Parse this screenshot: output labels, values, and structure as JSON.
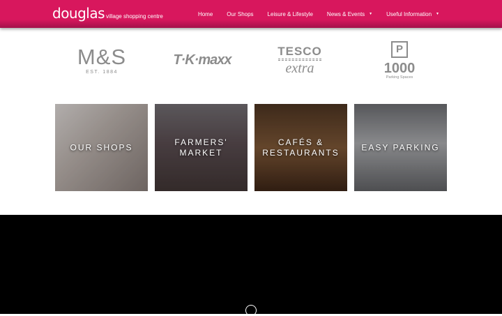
{
  "header": {
    "logo_main": "douglas",
    "logo_sub": "village shopping centre",
    "nav": [
      {
        "label": "Home",
        "has_dropdown": false
      },
      {
        "label": "Our Shops",
        "has_dropdown": false
      },
      {
        "label": "Leisure & Lifestyle",
        "has_dropdown": false
      },
      {
        "label": "News & Events",
        "has_dropdown": true
      },
      {
        "label": "Useful Information",
        "has_dropdown": true
      }
    ],
    "caret": "▼"
  },
  "brands": {
    "ms": {
      "name": "M&S",
      "sub": "EST. 1884"
    },
    "tkmaxx": {
      "name": "T·K·maxx"
    },
    "tesco": {
      "top": "TESCO",
      "bottom": "extra"
    },
    "parking": {
      "symbol": "P",
      "count": "1000",
      "sub": "Parking Spaces"
    }
  },
  "tiles": [
    {
      "label": "OUR SHOPS"
    },
    {
      "label": "FARMERS' MARKET"
    },
    {
      "label": "CAFÉS & RESTAURANTS"
    },
    {
      "label": "EASY PARKING"
    }
  ],
  "colors": {
    "brand": "#d8175d",
    "logo_grey": "#8c8c8c"
  }
}
